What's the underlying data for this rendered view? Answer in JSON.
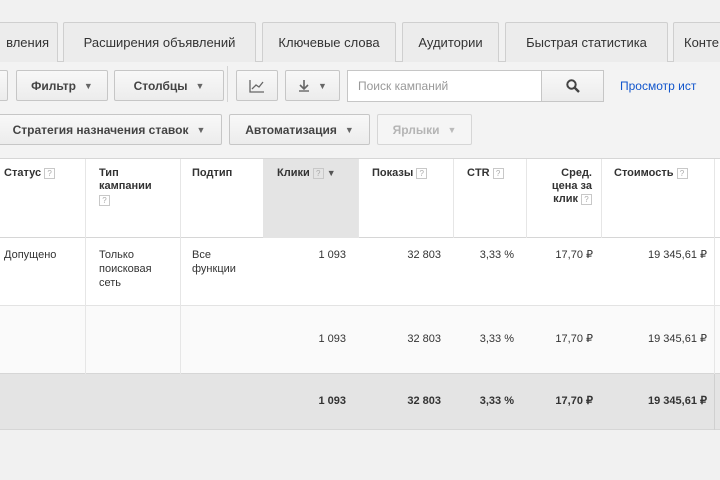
{
  "tabs": [
    "вления",
    "Расширения объявлений",
    "Ключевые слова",
    "Аудитории",
    "Быстрая статистика",
    "Конте"
  ],
  "toolbar": {
    "filter_label": "Фильтр",
    "columns_label": "Столбцы",
    "search_placeholder": "Поиск кампаний",
    "view_history_link": "Просмотр ист",
    "bid_strategy_label": "Стратегия назначения ставок",
    "automation_label": "Автоматизация",
    "labels_label": "Ярлыки"
  },
  "table": {
    "headers": {
      "status": "Статус",
      "campaign_type_1": "Тип",
      "campaign_type_2": "кампании",
      "subtype": "Подтип",
      "clicks": "Клики",
      "impressions": "Показы",
      "ctr": "CTR",
      "avg_cpc_1": "Сред.",
      "avg_cpc_2": "цена за",
      "avg_cpc_3": "клик",
      "cost": "Стоимость"
    },
    "row": {
      "status": "Допущено",
      "type_1": "Только",
      "type_2": "поисковая",
      "type_3": "сеть",
      "subtype_1": "Все",
      "subtype_2": "функции",
      "clicks": "1 093",
      "impressions": "32 803",
      "ctr": "3,33 %",
      "avg_cpc": "17,70 ₽",
      "cost": "19 345,61 ₽"
    },
    "subtotal": {
      "clicks": "1 093",
      "impressions": "32 803",
      "ctr": "3,33 %",
      "avg_cpc": "17,70 ₽",
      "cost": "19 345,61 ₽"
    },
    "total": {
      "clicks": "1 093",
      "impressions": "32 803",
      "ctr": "3,33 %",
      "avg_cpc": "17,70 ₽",
      "cost": "19 345,61 ₽"
    }
  }
}
